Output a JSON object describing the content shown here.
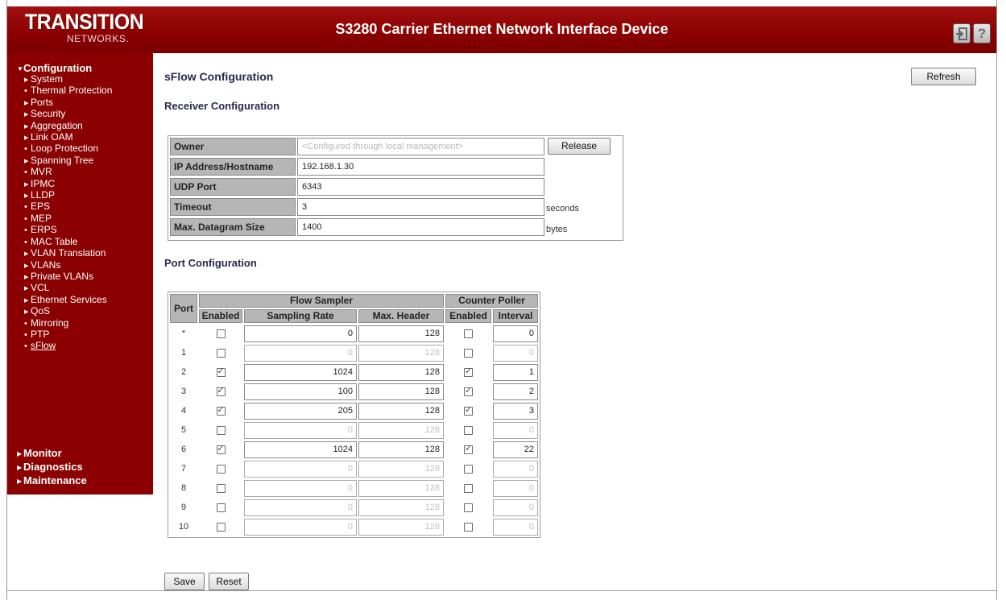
{
  "header": {
    "logo_main": "TRANSITION",
    "logo_sub": "NETWORKS.",
    "title": "S3280 Carrier Ethernet Network Interface Device",
    "logout_icon": "logout-icon",
    "help_label": "?"
  },
  "sidebar": {
    "configuration": "Configuration",
    "items": [
      {
        "label": "System",
        "marker": "arrow"
      },
      {
        "label": "Thermal Protection",
        "marker": "dot"
      },
      {
        "label": "Ports",
        "marker": "arrow"
      },
      {
        "label": "Security",
        "marker": "arrow"
      },
      {
        "label": "Aggregation",
        "marker": "arrow"
      },
      {
        "label": "Link OAM",
        "marker": "arrow"
      },
      {
        "label": "Loop Protection",
        "marker": "dot"
      },
      {
        "label": "Spanning Tree",
        "marker": "arrow"
      },
      {
        "label": "MVR",
        "marker": "dot"
      },
      {
        "label": "IPMC",
        "marker": "arrow"
      },
      {
        "label": "LLDP",
        "marker": "arrow"
      },
      {
        "label": "EPS",
        "marker": "dot"
      },
      {
        "label": "MEP",
        "marker": "dot"
      },
      {
        "label": "ERPS",
        "marker": "dot"
      },
      {
        "label": "MAC Table",
        "marker": "dot"
      },
      {
        "label": "VLAN Translation",
        "marker": "arrow"
      },
      {
        "label": "VLANs",
        "marker": "arrow"
      },
      {
        "label": "Private VLANs",
        "marker": "arrow"
      },
      {
        "label": "VCL",
        "marker": "arrow"
      },
      {
        "label": "Ethernet Services",
        "marker": "arrow"
      },
      {
        "label": "QoS",
        "marker": "arrow"
      },
      {
        "label": "Mirroring",
        "marker": "dot"
      },
      {
        "label": "PTP",
        "marker": "dot"
      },
      {
        "label": "sFlow",
        "marker": "dot",
        "current": true
      }
    ],
    "monitor": "Monitor",
    "diagnostics": "Diagnostics",
    "maintenance": "Maintenance"
  },
  "page": {
    "title": "sFlow Configuration",
    "refresh_label": "Refresh",
    "receiver_heading": "Receiver Configuration",
    "port_heading": "Port Configuration",
    "save_label": "Save",
    "reset_label": "Reset"
  },
  "receiver": {
    "owner_label": "Owner",
    "owner_value": "<Configured through local management>",
    "release_label": "Release",
    "ip_label": "IP Address/Hostname",
    "ip_value": "192.168.1.30",
    "udp_label": "UDP Port",
    "udp_value": "6343",
    "timeout_label": "Timeout",
    "timeout_value": "3",
    "timeout_unit": "seconds",
    "maxdg_label": "Max. Datagram Size",
    "maxdg_value": "1400",
    "maxdg_unit": "bytes"
  },
  "ports": {
    "headers": {
      "port": "Port",
      "flow_sampler": "Flow Sampler",
      "counter_poller": "Counter Poller",
      "enabled": "Enabled",
      "sampling_rate": "Sampling Rate",
      "max_header": "Max. Header",
      "cp_enabled": "Enabled",
      "interval": "Interval"
    },
    "rows": [
      {
        "port": "*",
        "fs_enabled": false,
        "rate": "0",
        "max_header": "128",
        "cp_enabled": false,
        "interval": "0",
        "disabled": false
      },
      {
        "port": "1",
        "fs_enabled": false,
        "rate": "0",
        "max_header": "128",
        "cp_enabled": false,
        "interval": "0",
        "disabled": true
      },
      {
        "port": "2",
        "fs_enabled": true,
        "rate": "1024",
        "max_header": "128",
        "cp_enabled": true,
        "interval": "1",
        "disabled": false
      },
      {
        "port": "3",
        "fs_enabled": true,
        "rate": "100",
        "max_header": "128",
        "cp_enabled": true,
        "interval": "2",
        "disabled": false
      },
      {
        "port": "4",
        "fs_enabled": true,
        "rate": "205",
        "max_header": "128",
        "cp_enabled": true,
        "interval": "3",
        "disabled": false
      },
      {
        "port": "5",
        "fs_enabled": false,
        "rate": "0",
        "max_header": "128",
        "cp_enabled": false,
        "interval": "0",
        "disabled": true
      },
      {
        "port": "6",
        "fs_enabled": true,
        "rate": "1024",
        "max_header": "128",
        "cp_enabled": true,
        "interval": "22",
        "disabled": false
      },
      {
        "port": "7",
        "fs_enabled": false,
        "rate": "0",
        "max_header": "128",
        "cp_enabled": false,
        "interval": "0",
        "disabled": true
      },
      {
        "port": "8",
        "fs_enabled": false,
        "rate": "0",
        "max_header": "128",
        "cp_enabled": false,
        "interval": "0",
        "disabled": true
      },
      {
        "port": "9",
        "fs_enabled": false,
        "rate": "0",
        "max_header": "128",
        "cp_enabled": false,
        "interval": "0",
        "disabled": true
      },
      {
        "port": "10",
        "fs_enabled": false,
        "rate": "0",
        "max_header": "128",
        "cp_enabled": false,
        "interval": "0",
        "disabled": true
      }
    ]
  }
}
